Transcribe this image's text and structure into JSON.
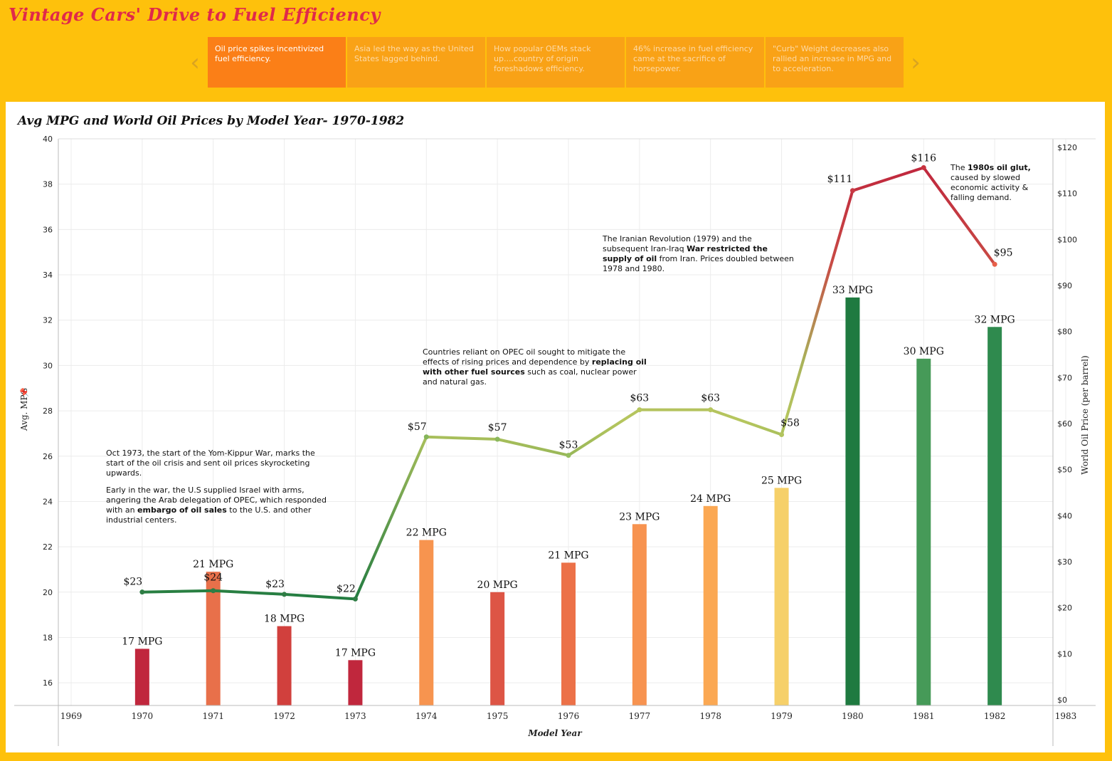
{
  "title": "Vintage Cars' Drive to Fuel Efficiency",
  "story_points": [
    "Oil price spikes incentivized fuel efficiency.",
    "Asia led the way as the United States lagged behind.",
    "How popular OEMs stack up....country of origin foreshadows efficiency.",
    "46% increase in fuel efficiency came at the sacrifice of horsepower.",
    "\"Curb\" Weight decreases also rallied an increase in MPG and to acceleration."
  ],
  "nav": {
    "prev": "‹",
    "next": "›"
  },
  "chart_data": {
    "type": "bar",
    "title": "Avg MPG and World Oil Prices by Model Year- 1970-1982",
    "xlabel": "Model Year",
    "ylabel": "Avg. MPG",
    "y2label": "World Oil Price (per barrel)",
    "x_ticks": [
      1969,
      1970,
      1971,
      1972,
      1973,
      1974,
      1975,
      1976,
      1977,
      1978,
      1979,
      1980,
      1981,
      1982,
      1983
    ],
    "xlim": [
      1969,
      1983
    ],
    "ylim": [
      15,
      40
    ],
    "y_ticks": [
      16,
      18,
      20,
      22,
      24,
      26,
      28,
      30,
      32,
      34,
      36,
      38,
      40
    ],
    "y2lim": [
      0,
      120
    ],
    "y2_ticks": [
      "$0",
      "$10",
      "$20",
      "$30",
      "$40",
      "$50",
      "$60",
      "$70",
      "$80",
      "$90",
      "$100",
      "$110",
      "$120"
    ],
    "categories": [
      1970,
      1971,
      1972,
      1973,
      1974,
      1975,
      1976,
      1977,
      1978,
      1979,
      1980,
      1981,
      1982
    ],
    "series": [
      {
        "name": "Avg. MPG",
        "type": "bar",
        "values": [
          17.5,
          20.9,
          18.5,
          17.0,
          22.3,
          20.0,
          21.3,
          23.0,
          23.8,
          24.6,
          33.0,
          30.3,
          31.7
        ],
        "labels": [
          "17 MPG",
          "21 MPG",
          "18 MPG",
          "17 MPG",
          "22 MPG",
          "20 MPG",
          "21 MPG",
          "23 MPG",
          "24 MPG",
          "25 MPG",
          "33 MPG",
          "30 MPG",
          "32 MPG"
        ],
        "colors": [
          "#c0273d",
          "#e8704a",
          "#d1403d",
          "#c0273d",
          "#f7944f",
          "#dd5545",
          "#ec7148",
          "#f79350",
          "#fba853",
          "#f6d069",
          "#1f7a40",
          "#469a58",
          "#2f8a4e"
        ]
      },
      {
        "name": "World Oil Price",
        "type": "line",
        "axis": "right",
        "values": [
          23.4,
          23.7,
          22.9,
          21.9,
          57.1,
          56.6,
          53.1,
          63.0,
          63.0,
          57.6,
          110.6,
          115.6,
          94.6
        ],
        "labels": [
          "$23",
          "$24",
          "$23",
          "$22",
          "$57",
          "$57",
          "$53",
          "$63",
          "$63",
          "$58",
          "$111",
          "$116",
          "$95"
        ]
      }
    ],
    "grid": true
  },
  "annotations": {
    "a1_p1": "Oct 1973, the start of the Yom-Kippur War, marks the start of the oil crisis  and sent oil prices skyrocketing upwards.",
    "a1_p2a": "Early in the war, the U.S supplied Israel with arms, angering the Arab delegation of OPEC,  which responded with an ",
    "a1_p2b": "embargo of oil sales",
    "a1_p2c": " to the U.S. and other industrial centers.",
    "a2a": "Countries reliant on OPEC oil sought to mitigate the effects of rising prices and dependence by ",
    "a2b": "replacing oil with other fuel sources",
    "a2c": " such as coal, nuclear power and natural gas.",
    "a3a": "The Iranian Revolution (1979) and the subsequent Iran-Iraq ",
    "a3b": "War restricted the supply of oil",
    "a3c": " from Iran.  Prices doubled between 1978 and 1980.",
    "a4a": "The ",
    "a4b": "1980s oil glut,",
    "a4c": " caused by slowed economic activity & falling demand."
  }
}
